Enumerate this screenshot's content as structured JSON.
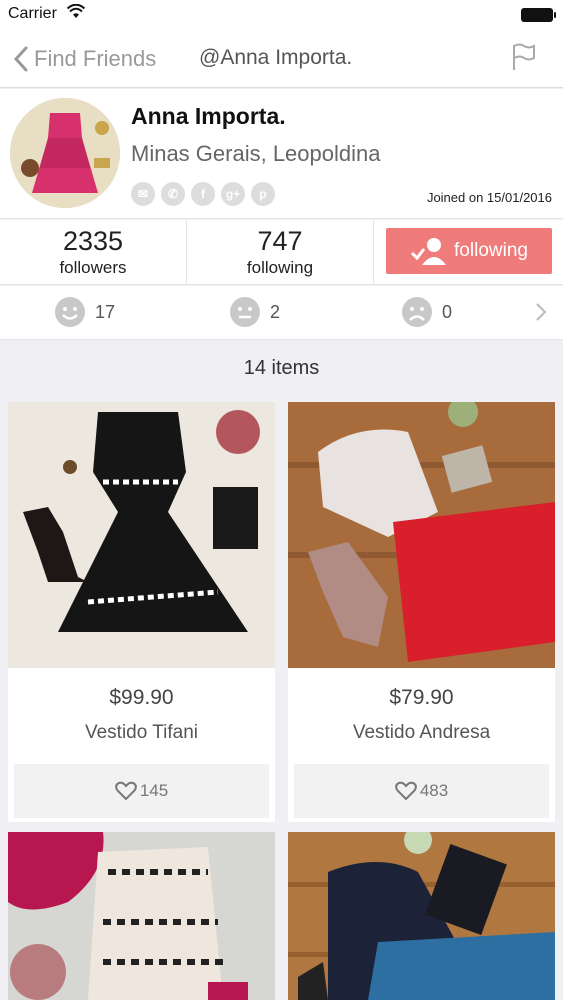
{
  "status_bar": {
    "carrier": "Carrier"
  },
  "nav": {
    "back_label": "Find Friends",
    "title": "@Anna Importa."
  },
  "profile": {
    "name": "Anna Importa.",
    "location": "Minas Gerais, Leopoldina",
    "joined": "Joined on 15/01/2016"
  },
  "stats": {
    "followers_count": "2335",
    "followers_label": "followers",
    "following_count": "747",
    "following_label": "following",
    "follow_button_label": "following"
  },
  "ratings": {
    "positive": "17",
    "neutral": "2",
    "negative": "0"
  },
  "items_count": "14 items",
  "products": [
    {
      "price": "$99.90",
      "title": "Vestido Tifani",
      "likes": "145"
    },
    {
      "price": "$79.90",
      "title": "Vestido Andresa",
      "likes": "483"
    },
    {
      "price": "",
      "title": "",
      "likes": ""
    },
    {
      "price": "",
      "title": "",
      "likes": ""
    }
  ],
  "colors": {
    "accent": "#ef7b7b",
    "background": "#efeff4"
  }
}
